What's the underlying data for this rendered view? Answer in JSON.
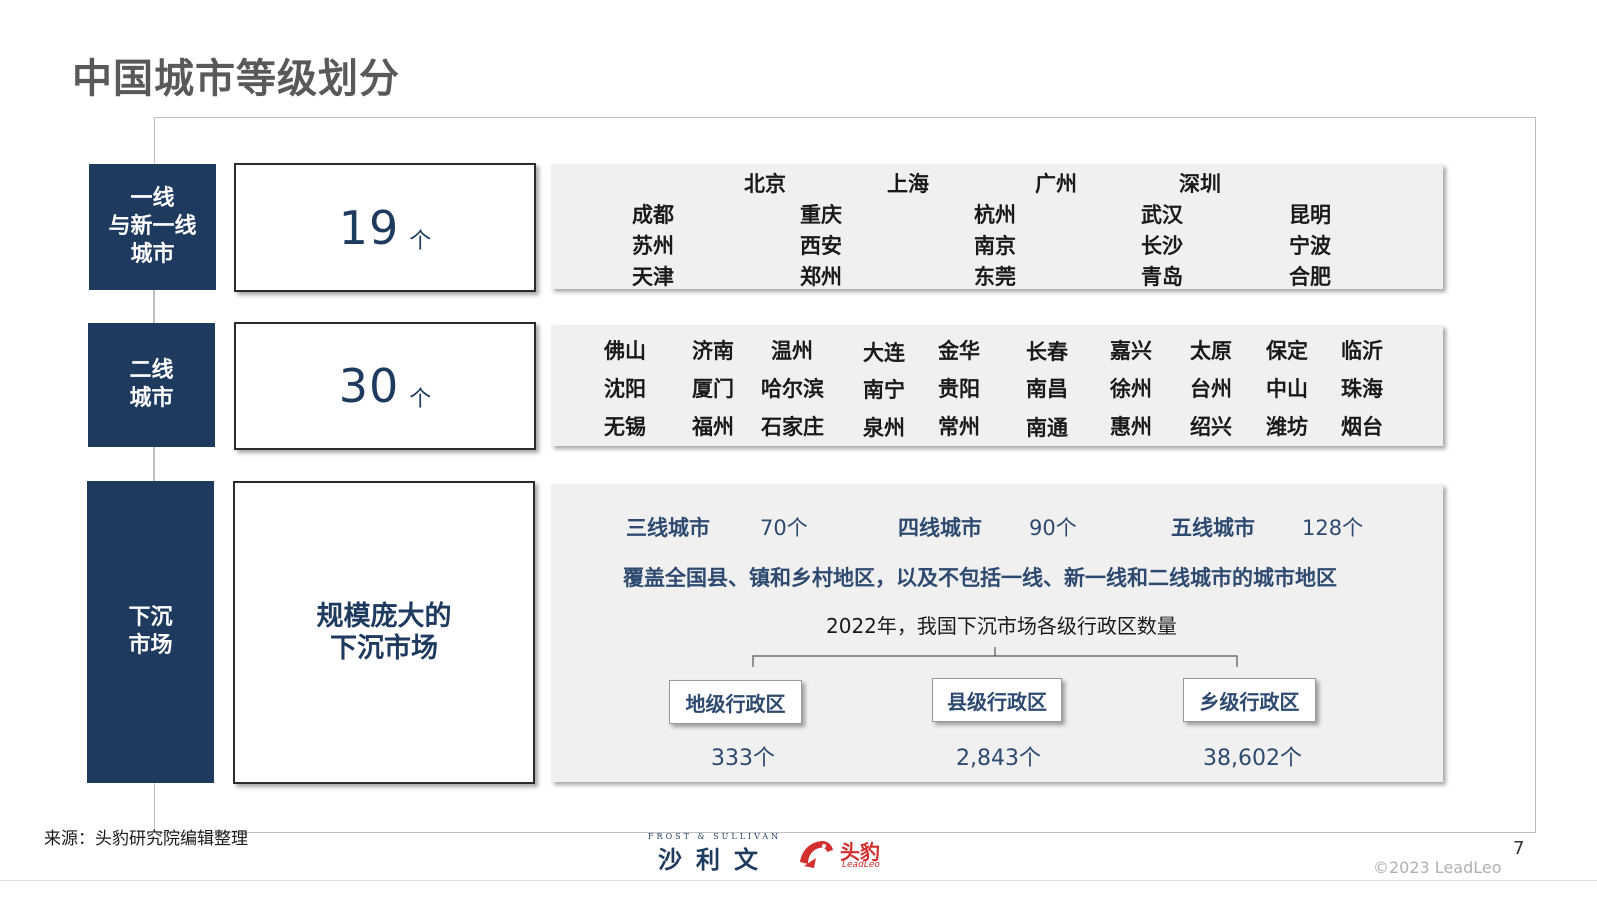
{
  "title": "中国城市等级划分",
  "tiers": {
    "first": {
      "label": "一线\n与新一线\n城市",
      "count": "19",
      "unit": "个",
      "top_cities": [
        "北京",
        "上海",
        "广州",
        "深圳"
      ],
      "new_cities": [
        [
          "成都",
          "重庆",
          "杭州",
          "武汉",
          "昆明"
        ],
        [
          "苏州",
          "西安",
          "南京",
          "长沙",
          "宁波"
        ],
        [
          "天津",
          "郑州",
          "东莞",
          "青岛",
          "合肥"
        ]
      ]
    },
    "second": {
      "label": "二线\n城市",
      "count": "30",
      "unit": "个",
      "cities": [
        [
          "佛山",
          "济南",
          "温州",
          "大连",
          "金华",
          "长春",
          "嘉兴",
          "太原",
          "保定",
          "临沂"
        ],
        [
          "沈阳",
          "厦门",
          "哈尔滨",
          "南宁",
          "贵阳",
          "南昌",
          "徐州",
          "台州",
          "中山",
          "珠海"
        ],
        [
          "无锡",
          "福州",
          "石家庄",
          "泉州",
          "常州",
          "南通",
          "惠州",
          "绍兴",
          "潍坊",
          "烟台"
        ]
      ]
    },
    "sinking": {
      "label": "下沉\n市场",
      "text": "规模庞大的\n下沉市场",
      "tiers": [
        {
          "label": "三线城市",
          "count": "70个"
        },
        {
          "label": "四线城市",
          "count": "90个"
        },
        {
          "label": "五线城市",
          "count": "128个"
        }
      ],
      "description": "覆盖全国县、镇和乡村地区，以及不包括一线、新一线和二线城市的城市地区",
      "subtitle": "2022年，我国下沉市场各级行政区数量",
      "admin": [
        {
          "label": "地级行政区",
          "count": "333个"
        },
        {
          "label": "县级行政区",
          "count": "2,843个"
        },
        {
          "label": "乡级行政区",
          "count": "38,602个"
        }
      ]
    }
  },
  "footer": {
    "source": "来源：头豹研究院编辑整理",
    "page": "7",
    "copyright": "©2023 LeadLeo",
    "logo_fs_small": "FROST & SULLIVAN",
    "logo_fs_big": "沙利文",
    "logo_ll_text": "头豹",
    "logo_ll_sub": "LeadLeo"
  }
}
